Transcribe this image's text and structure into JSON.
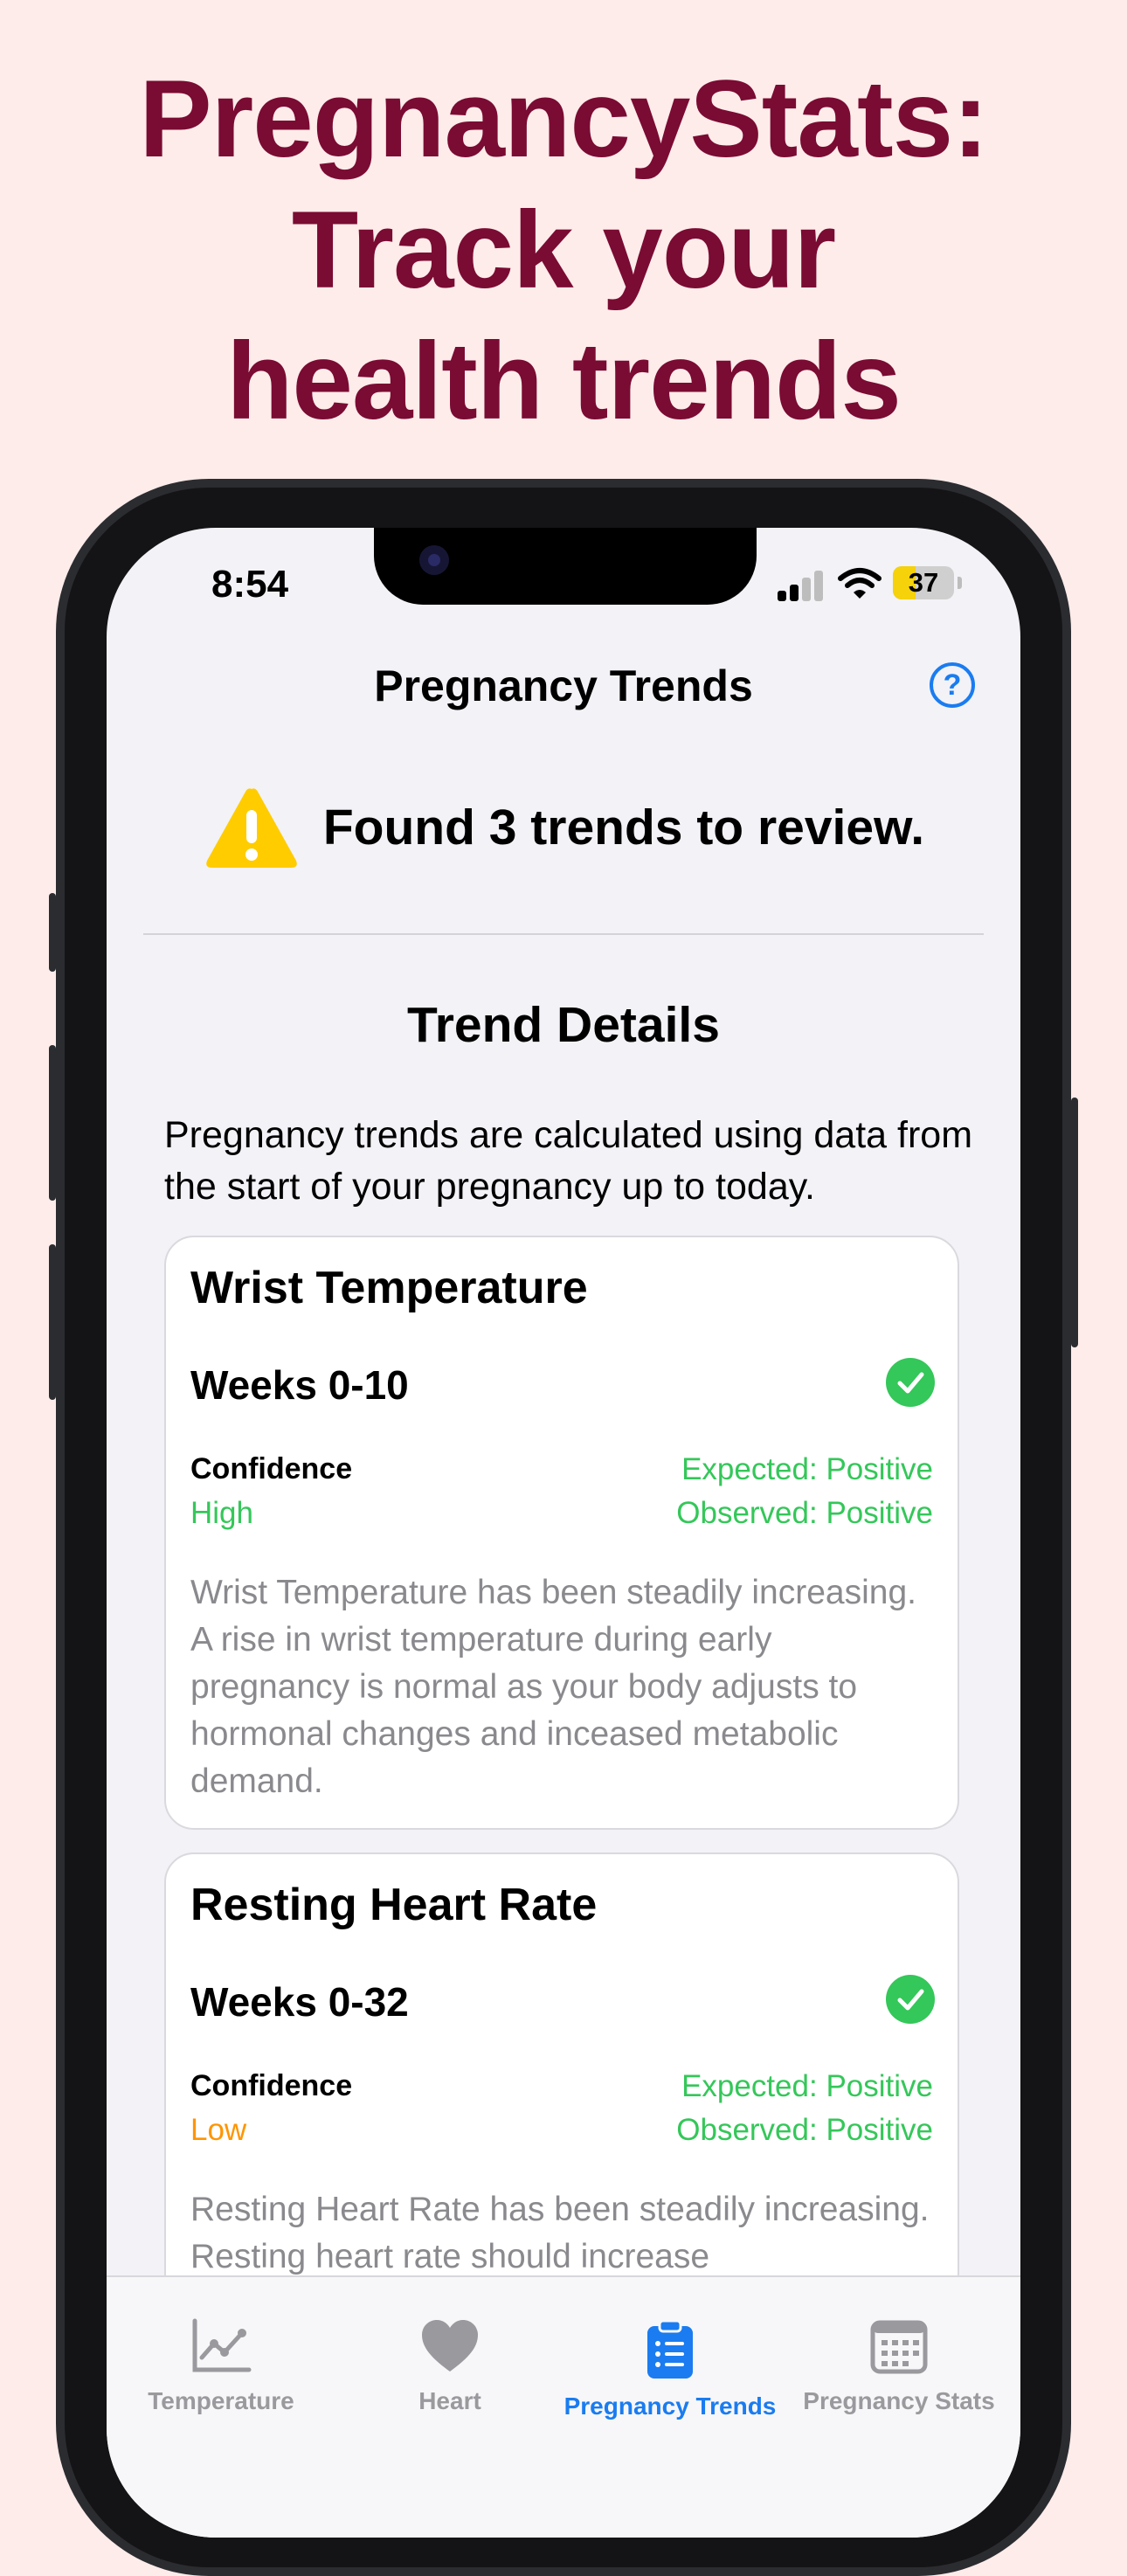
{
  "headline": [
    "PregnancyStats:",
    "Track your",
    "health trends"
  ],
  "status_bar": {
    "time": "8:54",
    "battery": "37"
  },
  "nav": {
    "title": "Pregnancy Trends",
    "help_icon": "question-circle-icon",
    "help_glyph": "?"
  },
  "banner": {
    "icon": "warning-triangle-icon",
    "text": "Found 3 trends to review."
  },
  "section": {
    "title": "Trend Details",
    "intro": "Pregnancy trends are calculated using data from the start of your pregnancy up to today."
  },
  "cards": [
    {
      "title": "Wrist Temperature",
      "weeks": "Weeks 0-10",
      "confidence_label": "Confidence",
      "confidence_value": "High",
      "confidence_color": "#34c759",
      "expected": "Expected: Positive",
      "observed": "Observed: Positive",
      "description": "Wrist Temperature has been steadily increasing. A rise in wrist temperature during early pregnancy is normal as your body adjusts to hormonal changes and inceased metabolic demand."
    },
    {
      "title": "Resting Heart Rate",
      "weeks": "Weeks 0-32",
      "confidence_label": "Confidence",
      "confidence_value": "Low",
      "confidence_color": "#ff9500",
      "expected": "Expected: Positive",
      "observed": "Observed: Positive",
      "description": "Resting Heart Rate has been steadily increasing. Resting heart rate should increase"
    }
  ],
  "tabs": [
    {
      "label": "Temperature",
      "icon": "chart-line-icon",
      "active": false
    },
    {
      "label": "Heart",
      "icon": "heart-icon",
      "active": false
    },
    {
      "label": "Pregnancy Trends",
      "icon": "clipboard-list-icon",
      "active": true
    },
    {
      "label": "Pregnancy Stats",
      "icon": "calendar-icon",
      "active": false
    }
  ],
  "colors": {
    "accent": "#1a7cf0",
    "positive": "#34c759",
    "warning": "#ffcc00",
    "headline": "#7a0b33"
  }
}
